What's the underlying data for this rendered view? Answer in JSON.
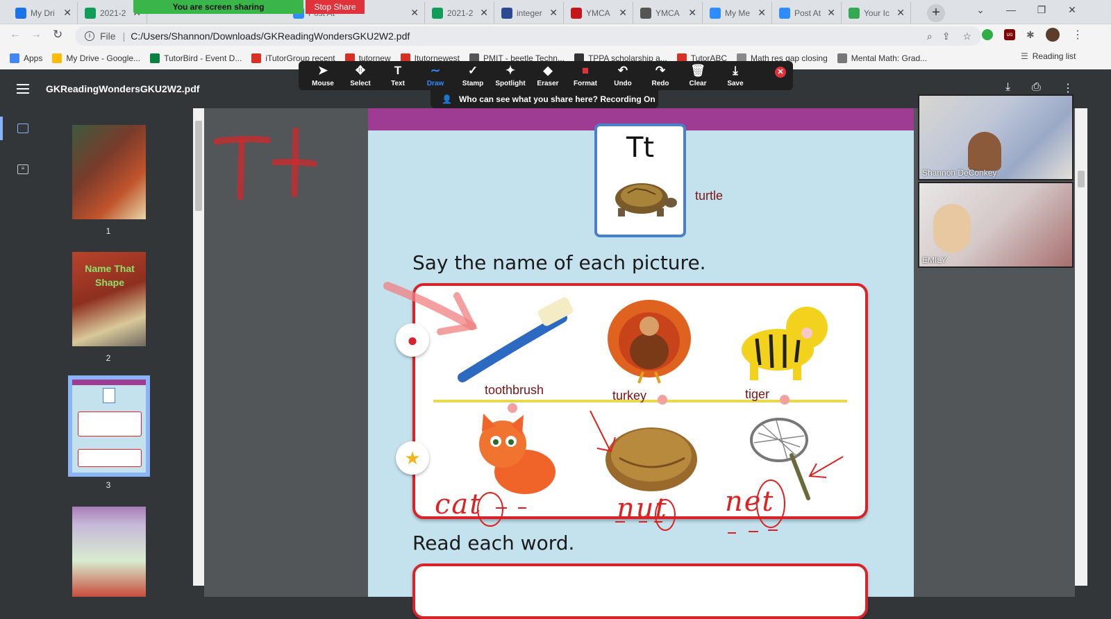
{
  "browser": {
    "tabs": [
      {
        "title": "My Dri",
        "icon": "google-drive-icon",
        "color": "#1a73e8"
      },
      {
        "title": "2021-2",
        "icon": "sheets-icon",
        "color": "#0f9d58"
      },
      {
        "title": "Post At",
        "icon": "zoom-icon",
        "color": "#2d8cff"
      },
      {
        "title": "2021-2",
        "icon": "sheets-icon",
        "color": "#0f9d58"
      },
      {
        "title": "integer",
        "icon": "mw-icon",
        "color": "#2b4a8f"
      },
      {
        "title": "YMCA",
        "icon": "ymca-icon",
        "color": "#c4161c"
      },
      {
        "title": "YMCA",
        "icon": "web-icon",
        "color": "#555555"
      },
      {
        "title": "My Me",
        "icon": "zoom-icon",
        "color": "#2d8cff"
      },
      {
        "title": "Post At",
        "icon": "zoom-icon",
        "color": "#2d8cff"
      },
      {
        "title": "Your Ic",
        "icon": "maps-icon",
        "color": "#34a853"
      }
    ],
    "url_label": "File",
    "url": "C:/Users/Shannon/Downloads/GKReadingWondersGKU2W2.pdf",
    "bookmarks": [
      {
        "label": "Apps",
        "color": "#4285f4"
      },
      {
        "label": "My Drive - Google...",
        "color": "#fbbc05"
      },
      {
        "label": "TutorBird - Event D...",
        "color": "#0b8043"
      },
      {
        "label": "iTutorGroup recent",
        "color": "#d93025"
      },
      {
        "label": "tutornew",
        "color": "#d93025"
      },
      {
        "label": "Itutornewest",
        "color": "#d93025"
      },
      {
        "label": "PMIT - beetle Techn...",
        "color": "#555555"
      },
      {
        "label": "TPPA scholarship a...",
        "color": "#333333"
      },
      {
        "label": "TutorABC",
        "color": "#d93025"
      },
      {
        "label": "Math res gap closing",
        "color": "#888888"
      },
      {
        "label": "Mental Math: Grad...",
        "color": "#777777"
      }
    ],
    "reading_list": "Reading list"
  },
  "share": {
    "banner": "You are screen sharing",
    "stop": "Stop Share",
    "notice": "Who can see what you share here? Recording On"
  },
  "zoom_toolbar": [
    {
      "label": "Mouse",
      "icon": "mouse-pointer-icon",
      "glyph": "➤"
    },
    {
      "label": "Select",
      "icon": "select-move-icon",
      "glyph": "✥"
    },
    {
      "label": "Text",
      "icon": "text-icon",
      "glyph": "T"
    },
    {
      "label": "Draw",
      "icon": "draw-icon",
      "glyph": "∼"
    },
    {
      "label": "Stamp",
      "icon": "stamp-icon",
      "glyph": "✓"
    },
    {
      "label": "Spotlight",
      "icon": "spotlight-icon",
      "glyph": "✦"
    },
    {
      "label": "Eraser",
      "icon": "eraser-icon",
      "glyph": "◆"
    },
    {
      "label": "Format",
      "icon": "format-icon",
      "glyph": "■"
    },
    {
      "label": "Undo",
      "icon": "undo-icon",
      "glyph": "↶"
    },
    {
      "label": "Redo",
      "icon": "redo-icon",
      "glyph": "↷"
    },
    {
      "label": "Clear",
      "icon": "trash-icon",
      "glyph": "🗑"
    },
    {
      "label": "Save",
      "icon": "save-icon",
      "glyph": "⤓"
    }
  ],
  "pdf": {
    "title": "GKReadingWondersGKU2W2.pdf",
    "pages": [
      "1",
      "2",
      "3"
    ],
    "thumb2_text": "Name That Shape",
    "letter_card": "Tt",
    "letter_word": "turtle",
    "say_prompt": "Say the name of each picture.",
    "row1_words": [
      "toothbrush",
      "turkey",
      "tiger"
    ],
    "read_prompt": "Read each word.",
    "handwriting": [
      "Tt",
      "cat",
      "nut",
      "net"
    ]
  },
  "participants": [
    {
      "name": "Shannon DeConkey"
    },
    {
      "name": "EMILY"
    }
  ]
}
